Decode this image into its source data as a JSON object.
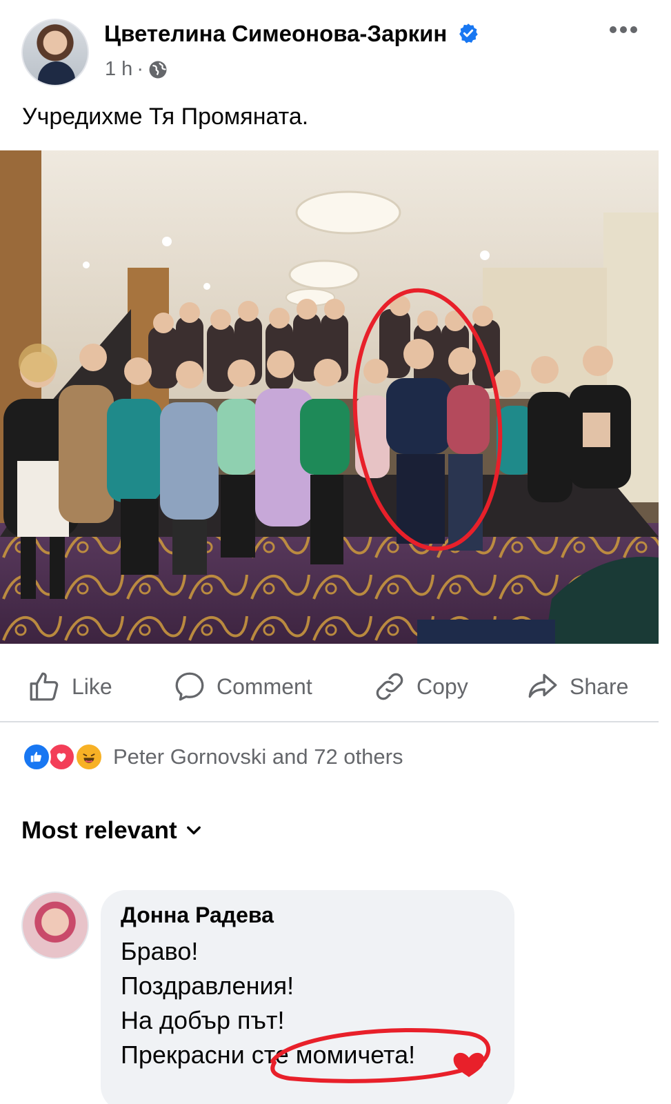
{
  "post": {
    "author": "Цветелина Симеонова-Заркин",
    "time": "1 h",
    "separator": "·",
    "text": "Учредихме Тя Промяната."
  },
  "actions": {
    "like": "Like",
    "comment": "Comment",
    "copy": "Copy",
    "share": "Share"
  },
  "reactions": {
    "summary": "Peter Gornovski and 72 others",
    "icons": [
      "like-icon",
      "love-icon",
      "haha-icon"
    ]
  },
  "sort": {
    "label": "Most relevant"
  },
  "comment": {
    "author": "Донна Радева",
    "lines": [
      "Браво!",
      "Поздравления!",
      "На добър път!",
      "Прекрасни сте момичета!"
    ]
  },
  "colors": {
    "verified": "#1877f2",
    "like_reaction": "#1877f2",
    "love_reaction": "#f33e58",
    "haha_reaction": "#f7b125",
    "annotation_red": "#e8202a"
  }
}
